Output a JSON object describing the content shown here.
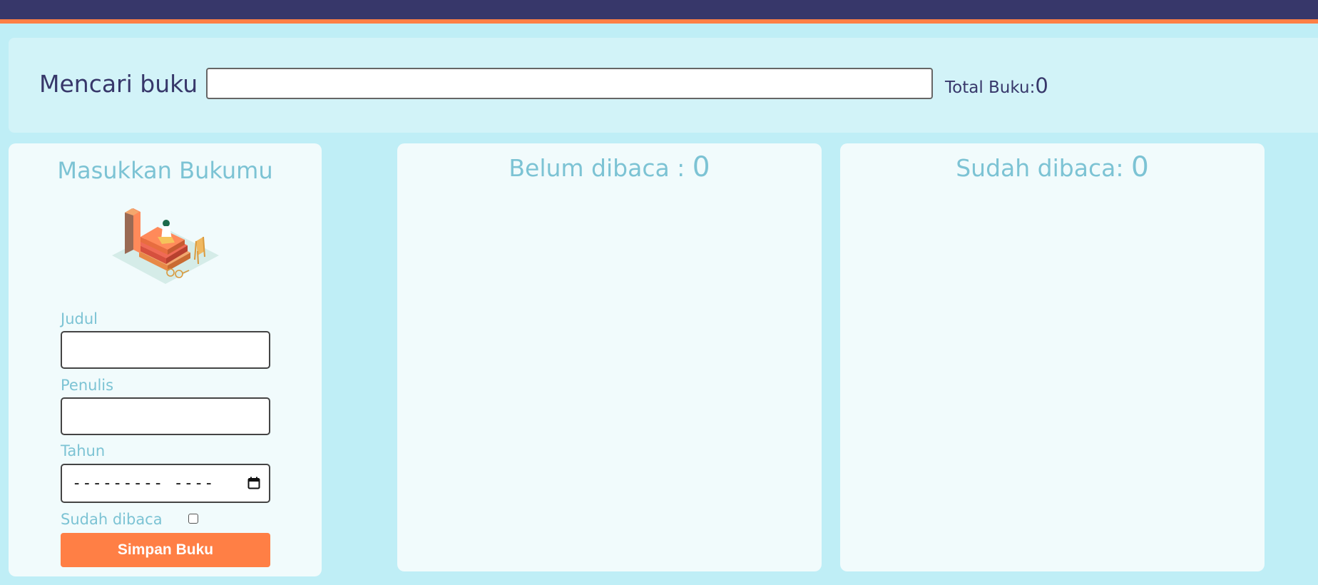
{
  "header": {
    "bar_color": "#37376a",
    "stripe_color": "#ff7f45"
  },
  "search": {
    "label": "Mencari buku",
    "value": "",
    "placeholder": "",
    "total_label": "Total Buku:",
    "total_count": "0"
  },
  "form": {
    "title": "Masukkan Bukumu",
    "illustration_icon": "reading-books-illustration",
    "title_label": "Judul",
    "title_value": "",
    "author_label": "Penulis",
    "author_value": "",
    "year_label": "Tahun",
    "year_placeholder": "--------- ----",
    "year_icon": "calendar-icon",
    "read_label": "Sudah dibaca",
    "read_checked": false,
    "submit_label": "Simpan Buku"
  },
  "shelves": {
    "unread_title": "Belum dibaca : ",
    "unread_count": "0",
    "read_title": "Sudah dibaca: ",
    "read_count": "0"
  },
  "colors": {
    "background": "#bfeef6",
    "accent": "#7cc3d4",
    "button": "#ff7f45",
    "text_dark": "#37376a"
  }
}
